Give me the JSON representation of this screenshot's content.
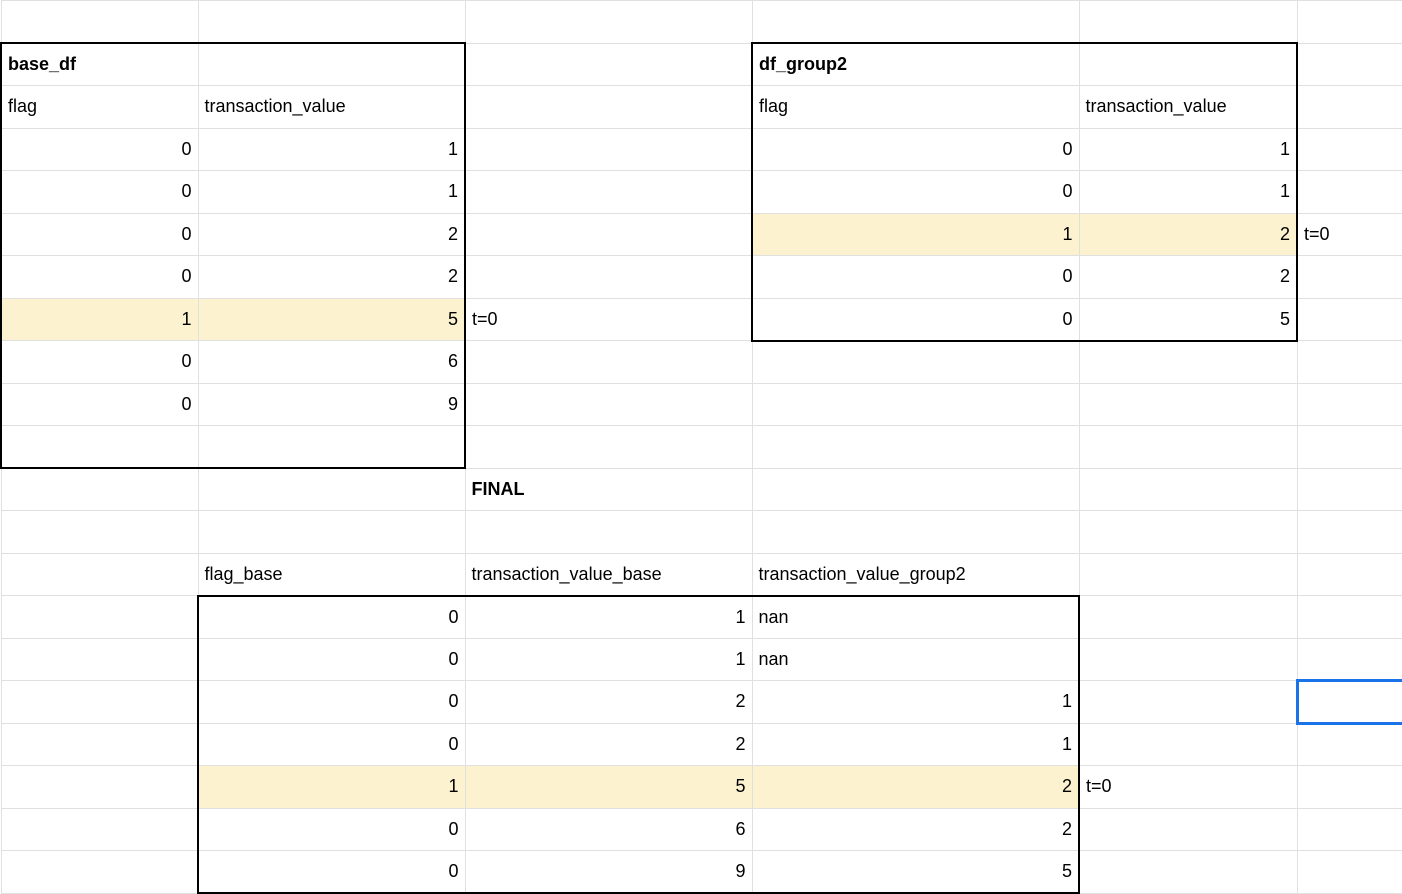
{
  "titles": {
    "base_df": "base_df",
    "df_group2": "df_group2",
    "final": "FINAL"
  },
  "headers": {
    "flag": "flag",
    "transaction_value": "transaction_value",
    "flag_base": "flag_base",
    "transaction_value_base": "transaction_value_base",
    "transaction_value_group2": "transaction_value_group2"
  },
  "annotations": {
    "t0": "t=0"
  },
  "base_df": {
    "rows": [
      {
        "flag": "0",
        "transaction_value": "1"
      },
      {
        "flag": "0",
        "transaction_value": "1"
      },
      {
        "flag": "0",
        "transaction_value": "2"
      },
      {
        "flag": "0",
        "transaction_value": "2"
      },
      {
        "flag": "1",
        "transaction_value": "5",
        "highlight": true,
        "annotation": "t=0"
      },
      {
        "flag": "0",
        "transaction_value": "6"
      },
      {
        "flag": "0",
        "transaction_value": "9"
      }
    ]
  },
  "df_group2": {
    "rows": [
      {
        "flag": "0",
        "transaction_value": "1"
      },
      {
        "flag": "0",
        "transaction_value": "1"
      },
      {
        "flag": "1",
        "transaction_value": "2",
        "highlight": true,
        "annotation": "t=0"
      },
      {
        "flag": "0",
        "transaction_value": "2"
      },
      {
        "flag": "0",
        "transaction_value": "5"
      }
    ]
  },
  "final": {
    "rows": [
      {
        "flag_base": "0",
        "transaction_value_base": "1",
        "transaction_value_group2": "nan"
      },
      {
        "flag_base": "0",
        "transaction_value_base": "1",
        "transaction_value_group2": "nan"
      },
      {
        "flag_base": "0",
        "transaction_value_base": "2",
        "transaction_value_group2": "1"
      },
      {
        "flag_base": "0",
        "transaction_value_base": "2",
        "transaction_value_group2": "1"
      },
      {
        "flag_base": "1",
        "transaction_value_base": "5",
        "transaction_value_group2": "2",
        "highlight": true,
        "annotation": "t=0"
      },
      {
        "flag_base": "0",
        "transaction_value_base": "6",
        "transaction_value_group2": "2"
      },
      {
        "flag_base": "0",
        "transaction_value_base": "9",
        "transaction_value_group2": "5"
      }
    ]
  }
}
